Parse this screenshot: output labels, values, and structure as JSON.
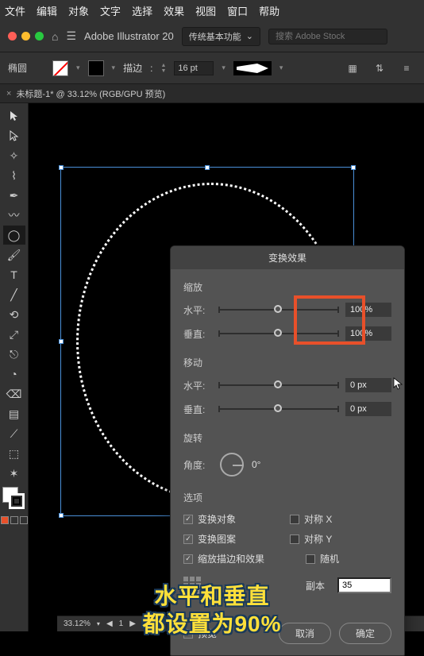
{
  "menu": {
    "items": [
      "文件",
      "编辑",
      "对象",
      "文字",
      "选择",
      "效果",
      "视图",
      "窗口",
      "帮助"
    ]
  },
  "appbar": {
    "title": "Adobe Illustrator 20",
    "workspace": "传统基本功能",
    "search_placeholder": "搜索 Adobe Stock"
  },
  "controlbar": {
    "shape": "椭圆",
    "stroke_label": "描边",
    "stroke_value": "16 pt"
  },
  "tab": {
    "title": "未标题-1* @ 33.12% (RGB/GPU 预览)"
  },
  "dialog": {
    "title": "变换效果",
    "scale": {
      "label": "缩放",
      "h_label": "水平",
      "v_label": "垂直",
      "h_value": "100%",
      "v_value": "100%"
    },
    "move": {
      "label": "移动",
      "h_label": "水平",
      "v_label": "垂直",
      "h_value": "0 px",
      "v_value": "0 px"
    },
    "rotate": {
      "label": "旋转",
      "angle_label": "角度",
      "angle_value": "0°"
    },
    "options": {
      "label": "选项",
      "transform_obj": "变换对象",
      "transform_pattern": "变换图案",
      "scale_strokes": "缩放描边和效果",
      "reflect_x": "对称 X",
      "reflect_y": "对称 Y",
      "random": "随机"
    },
    "copies": {
      "label": "副本",
      "value": "35"
    },
    "preview": "预览",
    "cancel": "取消",
    "ok": "确定"
  },
  "status": {
    "zoom": "33.12%",
    "page": "1"
  },
  "caption": {
    "line1": "水平和垂直",
    "line2": "都设置为90%"
  }
}
